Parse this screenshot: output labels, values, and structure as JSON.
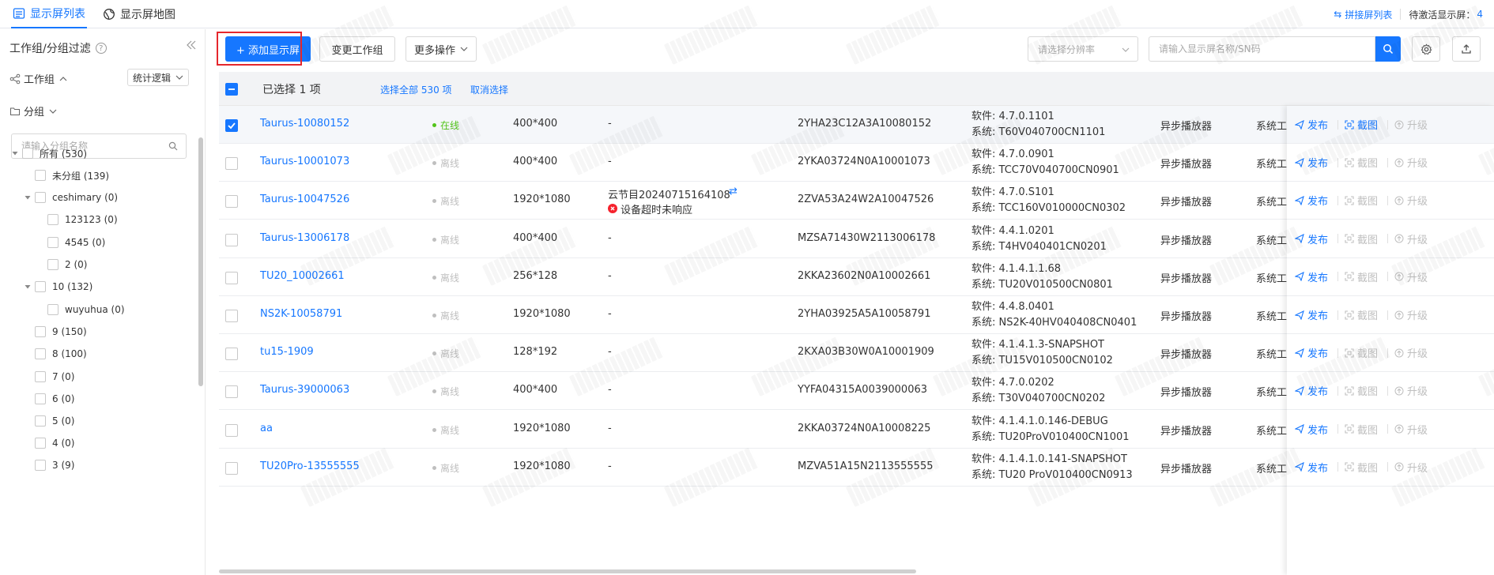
{
  "tabs": [
    {
      "label": "显示屏列表",
      "icon": "list-icon"
    },
    {
      "label": "显示屏地图",
      "icon": "globe-icon"
    }
  ],
  "topright": {
    "splice_label": "拼接屏列表",
    "pending_label": "待激活显示屏：",
    "pending_count": "4"
  },
  "sidebar": {
    "title": "工作组/分组过滤",
    "workgroup_label": "工作组",
    "stat_logic": "统计逻辑",
    "group_label": "分组",
    "search_placeholder": "请输入分组名称",
    "tree": [
      {
        "label": "所有 (530)",
        "level": 0,
        "arrow": true
      },
      {
        "label": "未分组 (139)",
        "level": 1,
        "arrow": false
      },
      {
        "label": "ceshimary (0)",
        "level": 1,
        "arrow": true
      },
      {
        "label": "123123 (0)",
        "level": 2,
        "arrow": false
      },
      {
        "label": "4545 (0)",
        "level": 2,
        "arrow": false
      },
      {
        "label": "2 (0)",
        "level": 2,
        "arrow": false
      },
      {
        "label": "10 (132)",
        "level": 1,
        "arrow": true
      },
      {
        "label": "wuyuhua (0)",
        "level": 2,
        "arrow": false
      },
      {
        "label": "9 (150)",
        "level": 1,
        "arrow": false
      },
      {
        "label": "8 (100)",
        "level": 1,
        "arrow": false
      },
      {
        "label": "7 (0)",
        "level": 1,
        "arrow": false
      },
      {
        "label": "6 (0)",
        "level": 1,
        "arrow": false
      },
      {
        "label": "5 (0)",
        "level": 1,
        "arrow": false
      },
      {
        "label": "4 (0)",
        "level": 1,
        "arrow": false
      },
      {
        "label": "3 (9)",
        "level": 1,
        "arrow": false
      }
    ]
  },
  "toolbar": {
    "add_label": "+ 添加显示屏",
    "change_group_label": "变更工作组",
    "more_label": "更多操作",
    "resolution_placeholder": "请选择分辨率",
    "search_placeholder": "请输入显示屏名称/SN码"
  },
  "table": {
    "selected_text": "已选择 1 项",
    "select_all_text": "选择全部 530 项",
    "cancel_text": "取消选择",
    "sw_prefix": "软件: ",
    "sys_prefix": "系统: ",
    "actions": {
      "publish": "发布",
      "screenshot": "截图",
      "upgrade": "升级"
    },
    "rows": [
      {
        "name": "Taurus-10080152",
        "status": "在线",
        "online": true,
        "res": "400*400",
        "program": "-",
        "error": "",
        "sn": "2YHA23C12A3A10080152",
        "sw": "4.7.0.1101",
        "sys": "T60V040700CN1101",
        "player": "异步播放器",
        "systool": "系统工",
        "selected": true
      },
      {
        "name": "Taurus-10001073",
        "status": "离线",
        "online": false,
        "res": "400*400",
        "program": "-",
        "error": "",
        "sn": "2YKA03724N0A10001073",
        "sw": "4.7.0.0901",
        "sys": "TCC70V040700CN0901",
        "player": "异步播放器",
        "systool": "系统工",
        "selected": false
      },
      {
        "name": "Taurus-10047526",
        "status": "离线",
        "online": false,
        "res": "1920*1080",
        "program": "云节目20240715164108",
        "error": "设备超时未响应",
        "sn": "2ZVA53A24W2A10047526",
        "sw": "4.7.0.S101",
        "sys": "TCC160V010000CN0302",
        "player": "异步播放器",
        "systool": "系统工",
        "selected": false
      },
      {
        "name": "Taurus-13006178",
        "status": "离线",
        "online": false,
        "res": "400*400",
        "program": "-",
        "error": "",
        "sn": "MZSA71430W2113006178",
        "sw": "4.4.1.0201",
        "sys": "T4HV040401CN0201",
        "player": "异步播放器",
        "systool": "系统工",
        "selected": false
      },
      {
        "name": "TU20_10002661",
        "status": "离线",
        "online": false,
        "res": "256*128",
        "program": "-",
        "error": "",
        "sn": "2KKA23602N0A10002661",
        "sw": "4.1.4.1.1.68",
        "sys": "TU20V010500CN0801",
        "player": "异步播放器",
        "systool": "系统工",
        "selected": false
      },
      {
        "name": "NS2K-10058791",
        "status": "离线",
        "online": false,
        "res": "1920*1080",
        "program": "-",
        "error": "",
        "sn": "2YHA03925A5A10058791",
        "sw": "4.4.8.0401",
        "sys": "NS2K-40HV040408CN0401",
        "player": "异步播放器",
        "systool": "系统工",
        "selected": false
      },
      {
        "name": "tu15-1909",
        "status": "离线",
        "online": false,
        "res": "128*192",
        "program": "-",
        "error": "",
        "sn": "2KXA03B30W0A10001909",
        "sw": "4.1.4.1.3-SNAPSHOT",
        "sys": "TU15V010500CN0102",
        "player": "异步播放器",
        "systool": "系统工",
        "selected": false
      },
      {
        "name": "Taurus-39000063",
        "status": "离线",
        "online": false,
        "res": "400*400",
        "program": "-",
        "error": "",
        "sn": "YYFA04315A0039000063",
        "sw": "4.7.0.0202",
        "sys": "T30V040700CN0202",
        "player": "异步播放器",
        "systool": "系统工",
        "selected": false
      },
      {
        "name": "aa",
        "status": "离线",
        "online": false,
        "res": "1920*1080",
        "program": "-",
        "error": "",
        "sn": "2KKA03724N0A10008225",
        "sw": "4.1.4.1.0.146-DEBUG",
        "sys": "TU20ProV010400CN1001",
        "player": "异步播放器",
        "systool": "系统工",
        "selected": false
      },
      {
        "name": "TU20Pro-13555555",
        "status": "离线",
        "online": false,
        "res": "1920*1080",
        "program": "-",
        "error": "",
        "sn": "MZVA51A15N2113555555",
        "sw": "4.1.4.1.0.141-SNAPSHOT",
        "sys": "TU20 ProV010400CN0913",
        "player": "异步播放器",
        "systool": "系统工",
        "selected": false
      }
    ]
  },
  "colors": {
    "accent": "#1677ff",
    "online": "#52c41a",
    "offline": "#bfbfbf",
    "error": "#f5222d",
    "highlight": "#e5272d"
  }
}
